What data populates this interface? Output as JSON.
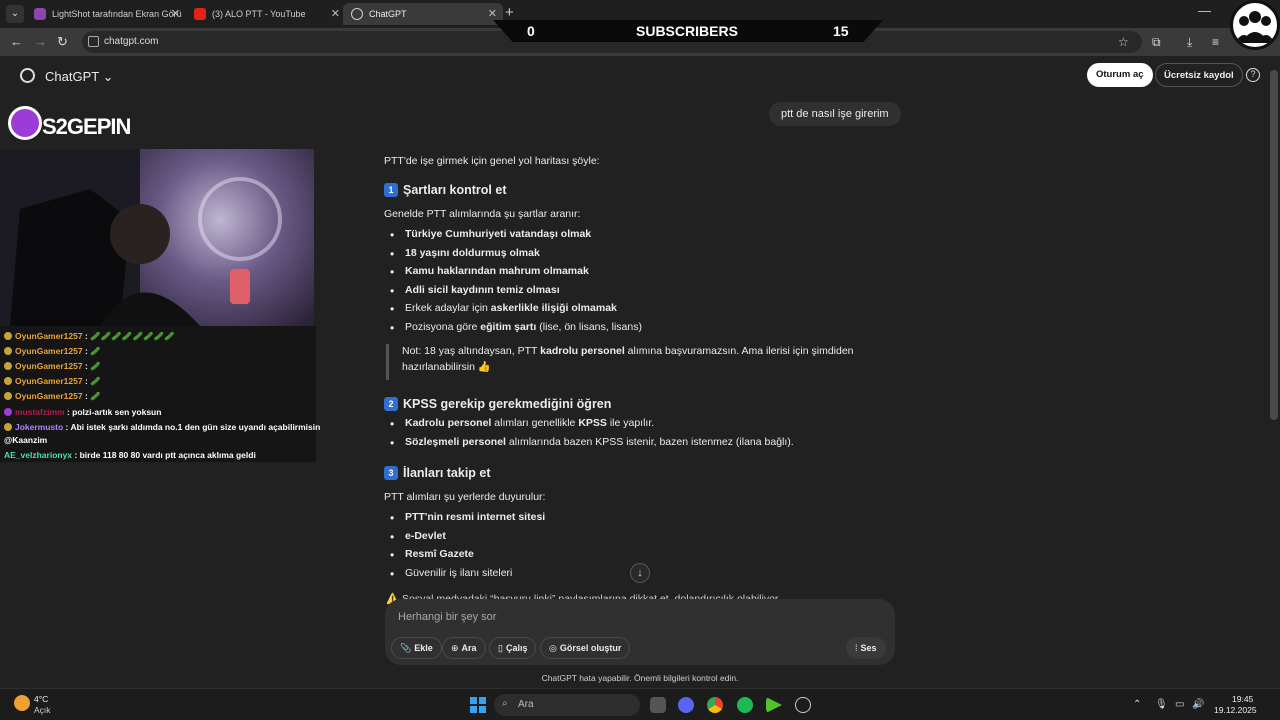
{
  "browser": {
    "tabs": [
      {
        "title": "LightShot tarafından Ekran Görü",
        "icon": "lightshot-icon",
        "color": "#8e44ad",
        "active": false
      },
      {
        "title": "(3) ALO PTT - YouTube",
        "icon": "youtube-icon",
        "color": "#e62117",
        "active": false
      },
      {
        "title": "ChatGPT",
        "icon": "chatgpt-icon",
        "color": "#cfcfcf",
        "active": true
      }
    ],
    "url": "chatgpt.com"
  },
  "overlay": {
    "subscribers_left": "0",
    "subscribers_label": "SUBSCRIBERS",
    "subscribers_right": "15",
    "brand": "S2GEPIN",
    "chat": [
      {
        "user": "OyunGamer1257",
        "msg": "🥒🥒🥒🥒🥒🥒🥒🥒",
        "color": "#e8a53a"
      },
      {
        "user": "OyunGamer1257",
        "msg": "🥒",
        "color": "#e8a53a"
      },
      {
        "user": "OyunGamer1257",
        "msg": "🥒",
        "color": "#e8a53a"
      },
      {
        "user": "OyunGamer1257",
        "msg": "🥒",
        "color": "#e8a53a"
      },
      {
        "user": "OyunGamer1257",
        "msg": "🥒",
        "color": "#e8a53a"
      },
      {
        "user": "mustafzimm",
        "msg": "polzi-artık sen yoksun",
        "color": "#b21d4a"
      },
      {
        "user": "Jokermusto",
        "msg": "Abi istek şarkı aldımda no.1 den gün size uyandı açabilirmisin",
        "color": "#b580ff"
      },
      {
        "user": "",
        "msg": "@Kaanzim",
        "color": "#ffffff"
      },
      {
        "user": "AE_velzharionyx",
        "msg": "birde 118 80 80 vardı ptt açınca aklıma geldi",
        "color": "#4de0a0"
      }
    ]
  },
  "header": {
    "title": "ChatGPT",
    "login": "Oturum aç",
    "signup": "Ücretsiz kaydol",
    "help": "?"
  },
  "conversation": {
    "user_message": "ptt de nasıl işe girerim",
    "intro": "PTT'de işe girmek için genel yol haritası şöyle:",
    "s1_num": "1",
    "s1_title": "Şartları kontrol et",
    "s1_lead": "Genelde PTT alımlarında şu şartlar aranır:",
    "s1_items": [
      "Türkiye Cumhuriyeti vatandaşı olmak",
      "18 yaşını doldurmuş olmak",
      "Kamu haklarından mahrum olmamak",
      "Adli sicil kaydının temiz olması"
    ],
    "s1_item5_pre": "Erkek adaylar için ",
    "s1_item5_bold": "askerlikle ilişiği olmamak",
    "s1_item6_pre": "Pozisyona göre ",
    "s1_item6_bold": "eğitim şartı",
    "s1_item6_post": " (lise, ön lisans, lisans)",
    "note_pre": "Not: 18 yaş altındaysan, PTT ",
    "note_bold": "kadrolu personel",
    "note_post": " alımına başvuramazsın. Ama ilerisi için şimdiden hazırlanabilirsin 👍",
    "s2_num": "2",
    "s2_title": "KPSS gerekip gerekmediğini öğren",
    "s2_item1_bold": "Kadrolu personel",
    "s2_item1_mid": " alımları genellikle ",
    "s2_item1_bold2": "KPSS",
    "s2_item1_post": " ile yapılır.",
    "s2_item2_bold": "Sözleşmeli personel",
    "s2_item2_post": " alımlarında bazen KPSS istenir, bazen istenmez (ilana bağlı).",
    "s3_num": "3",
    "s3_title": "İlanları takip et",
    "s3_lead": "PTT alımları şu yerlerde duyurulur:",
    "s3_items_bold": [
      "PTT'nin resmi internet sitesi",
      "e-Devlet",
      "Resmî Gazete"
    ],
    "s3_item4": "Güvenilir iş ilanı siteleri",
    "warning": "⚠️ Sosyal medyadaki “başvuru linki” paylaşımlarına dikkat et, dolandırıcılık olabiliyor."
  },
  "composer": {
    "placeholder": "Herhangi bir şey sor",
    "add": "Ekle",
    "search": "Ara",
    "study": "Çalış",
    "image": "Görsel oluştur",
    "voice": "Ses",
    "disclaimer": "ChatGPT hata yapabilir. Önemli bilgileri kontrol edin."
  },
  "taskbar": {
    "temp": "4°C",
    "condition": "Açık",
    "search": "Ara",
    "time": "19:45",
    "date": "19.12.2025"
  }
}
